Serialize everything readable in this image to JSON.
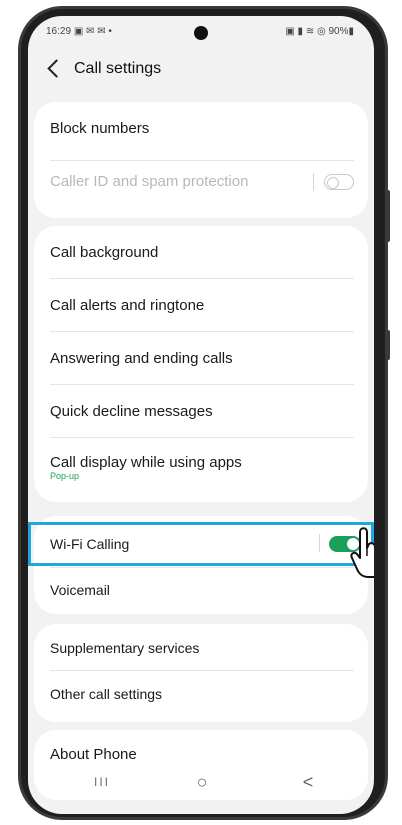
{
  "status_bar": {
    "time": "16:29",
    "left_icons": "▣ ✉ ✉ •",
    "right_icons": "▣ ▮ ≋ ◎ 90%▮"
  },
  "header": {
    "title": "Call settings"
  },
  "sections": [
    {
      "items": [
        {
          "label": "Block numbers"
        },
        {
          "label": "Caller ID and spam protection",
          "disabled": true,
          "toggle": "off"
        }
      ]
    },
    {
      "items": [
        {
          "label": "Call background"
        },
        {
          "label": "Call alerts and ringtone"
        },
        {
          "label": "Answering and ending calls"
        },
        {
          "label": "Quick decline messages"
        },
        {
          "label": "Call display while using apps",
          "sublabel": "Pop-up"
        }
      ]
    },
    {
      "items": [
        {
          "label": "Wi-Fi Calling",
          "toggle": "on",
          "highlighted": true
        },
        {
          "label": "Voicemail"
        }
      ]
    },
    {
      "items": [
        {
          "label": "Supplementary services"
        },
        {
          "label": "Other call settings"
        }
      ]
    },
    {
      "items": [
        {
          "label": "About Phone"
        }
      ]
    }
  ],
  "nav": {
    "recents_icon": "III",
    "home_icon": "○",
    "back_icon": "<"
  },
  "colors": {
    "accent_green": "#1aa05b",
    "highlight_blue": "#1ea7e1",
    "background": "#f2f2f2"
  }
}
